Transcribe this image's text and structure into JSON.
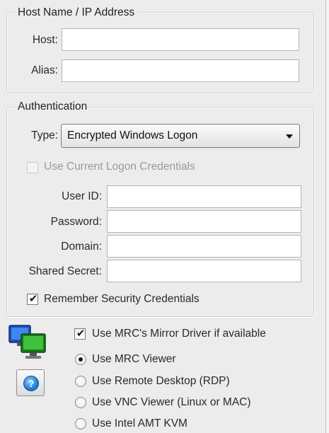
{
  "host_group": {
    "title": "Host Name / IP Address",
    "host_label": "Host:",
    "host_value": "",
    "alias_label": "Alias:",
    "alias_value": ""
  },
  "auth_group": {
    "title": "Authentication",
    "type_label": "Type:",
    "type_value": "Encrypted Windows Logon",
    "use_current_label": "Use Current Logon Credentials",
    "use_current_checked": false,
    "use_current_enabled": false,
    "user_id_label": "User ID:",
    "password_label": "Password:",
    "domain_label": "Domain:",
    "shared_secret_label": "Shared Secret:",
    "remember_label": "Remember Security Credentials",
    "remember_checked": true
  },
  "viewer": {
    "mirror_driver_label": "Use MRC's Mirror Driver if available",
    "mirror_driver_checked": true,
    "options": [
      {
        "label": "Use MRC Viewer",
        "selected": true
      },
      {
        "label": "Use Remote Desktop (RDP)",
        "selected": false
      },
      {
        "label": "Use VNC Viewer (Linux or MAC)",
        "selected": false
      },
      {
        "label": "Use Intel AMT KVM",
        "selected": false
      }
    ]
  },
  "icons": {
    "computers": "computers-icon",
    "help": "help-icon",
    "dropdown": "dropdown-arrow-icon"
  }
}
